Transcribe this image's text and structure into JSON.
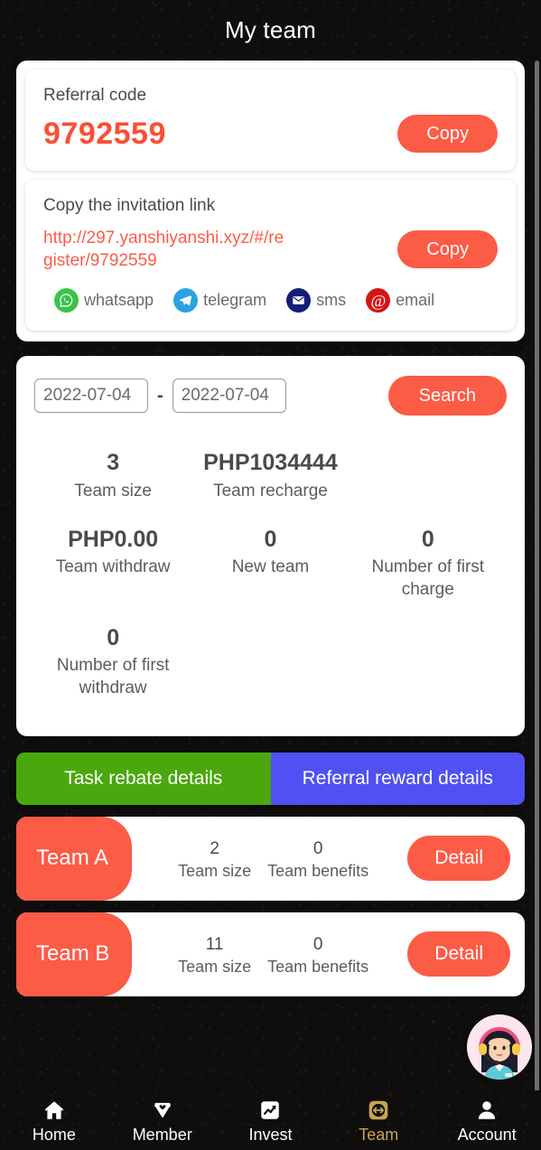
{
  "header": {
    "title": "My team"
  },
  "referral": {
    "label": "Referral code",
    "code": "9792559",
    "copy_label": "Copy"
  },
  "invitation": {
    "label": "Copy the invitation link",
    "url": "http://297.yanshiyanshi.xyz/#/register/9792559",
    "copy_label": "Copy",
    "share": [
      {
        "icon": "whatsapp-icon",
        "label": "whatsapp",
        "color": "#3ac34b"
      },
      {
        "icon": "telegram-icon",
        "label": "telegram",
        "color": "#2aa3e0"
      },
      {
        "icon": "sms-icon",
        "label": "sms",
        "color": "#141e78"
      },
      {
        "icon": "email-icon",
        "label": "email",
        "color": "#d61414"
      }
    ]
  },
  "search": {
    "start_date": "2022-07-04",
    "end_date": "2022-07-04",
    "separator": "-",
    "button_label": "Search"
  },
  "stats": [
    {
      "value": "3",
      "label": "Team size"
    },
    {
      "value": "PHP1034444",
      "label": "Team recharge"
    },
    {
      "value": "",
      "label": ""
    },
    {
      "value": "PHP0.00",
      "label": "Team withdraw"
    },
    {
      "value": "0",
      "label": "New team"
    },
    {
      "value": "0",
      "label": "Number of first charge"
    },
    {
      "value": "0",
      "label": "Number of first withdraw"
    }
  ],
  "tabs": [
    {
      "label": "Task rebate details",
      "color": "#4aa80e"
    },
    {
      "label": "Referral reward details",
      "color": "#5050f5"
    }
  ],
  "teams": [
    {
      "name": "Team A",
      "size_value": "2",
      "size_label": "Team size",
      "benefits_value": "0",
      "benefits_label": "Team benefits",
      "detail_label": "Detail"
    },
    {
      "name": "Team B",
      "size_value": "11",
      "size_label": "Team size",
      "benefits_value": "0",
      "benefits_label": "Team benefits",
      "detail_label": "Detail"
    }
  ],
  "support": {
    "icon": "customer-service-avatar-icon"
  },
  "bottom_nav": {
    "active_color": "#c9a44e",
    "items": [
      {
        "icon": "home-icon",
        "label": "Home",
        "active": false
      },
      {
        "icon": "diamond-heart-icon",
        "label": "Member",
        "active": false
      },
      {
        "icon": "chart-trend-icon",
        "label": "Invest",
        "active": false
      },
      {
        "icon": "team-arrows-icon",
        "label": "Team",
        "active": true
      },
      {
        "icon": "person-icon",
        "label": "Account",
        "active": false
      }
    ]
  },
  "theme": {
    "accent": "#fc5b46",
    "code_color": "#fb4e34",
    "background": "#100e0d"
  }
}
